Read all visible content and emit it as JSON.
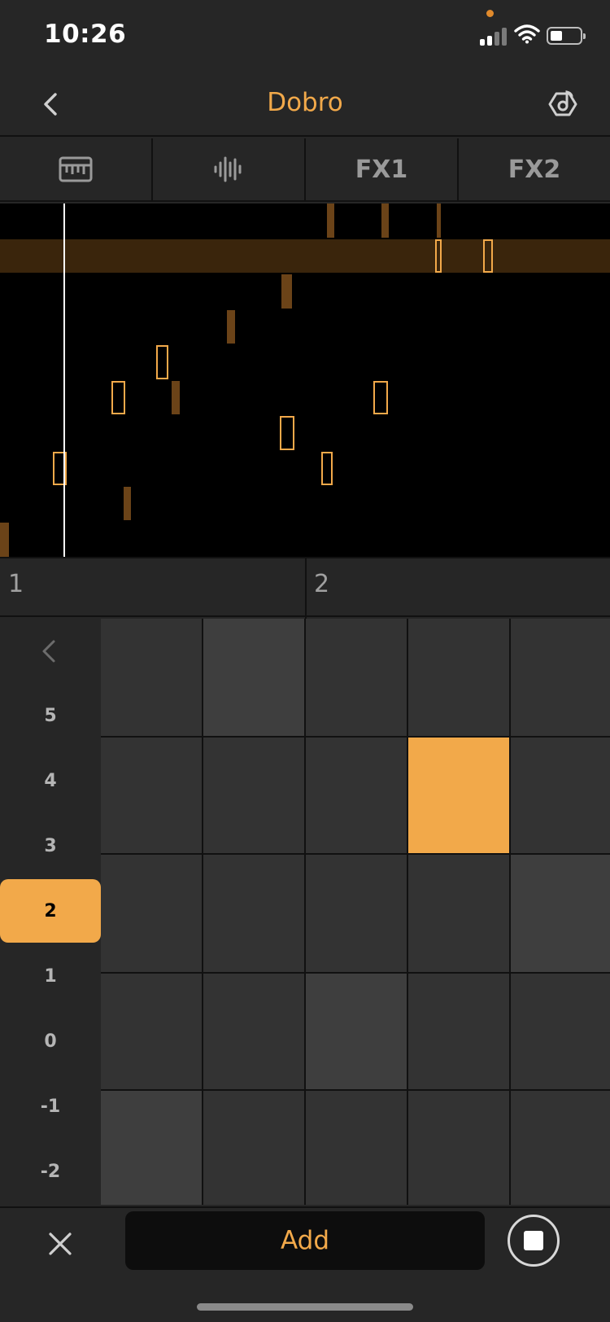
{
  "colors": {
    "accent": "#f2a94a",
    "note_fill": "#6b4318",
    "lane_highlight": "#3a250c",
    "pad": "#333333",
    "pad_light": "#3e3e3e",
    "pad_active": "#f2a94a",
    "orange_dot": "#e08a2c"
  },
  "status_bar": {
    "time": "10:26"
  },
  "nav": {
    "title": "Dobro",
    "back_icon": "chevron-left-icon",
    "settings_icon": "note-settings-icon"
  },
  "tabs": [
    {
      "icon": "ruler-icon",
      "label": ""
    },
    {
      "icon": "waveform-icon",
      "label": ""
    },
    {
      "icon": "",
      "label": "FX1"
    },
    {
      "icon": "",
      "label": "FX2"
    }
  ],
  "ruler": {
    "measures": [
      "1",
      "2"
    ]
  },
  "octave_panel": {
    "values": [
      "5",
      "4",
      "3",
      "2",
      "1",
      "0",
      "-1",
      "-2"
    ],
    "selected": "2"
  },
  "pad_grid": {
    "rows": 5,
    "columns": 5,
    "states": [
      [
        "off",
        "light",
        "off",
        "off",
        "off"
      ],
      [
        "off",
        "off",
        "off",
        "active",
        "off"
      ],
      [
        "off",
        "off",
        "off",
        "off",
        "light"
      ],
      [
        "off",
        "off",
        "light",
        "off",
        "off"
      ],
      [
        "light",
        "off",
        "off",
        "off",
        "off"
      ]
    ]
  },
  "bottom_bar": {
    "add_label": "Add",
    "close_icon": "close-icon",
    "stop_icon": "stop-icon"
  }
}
